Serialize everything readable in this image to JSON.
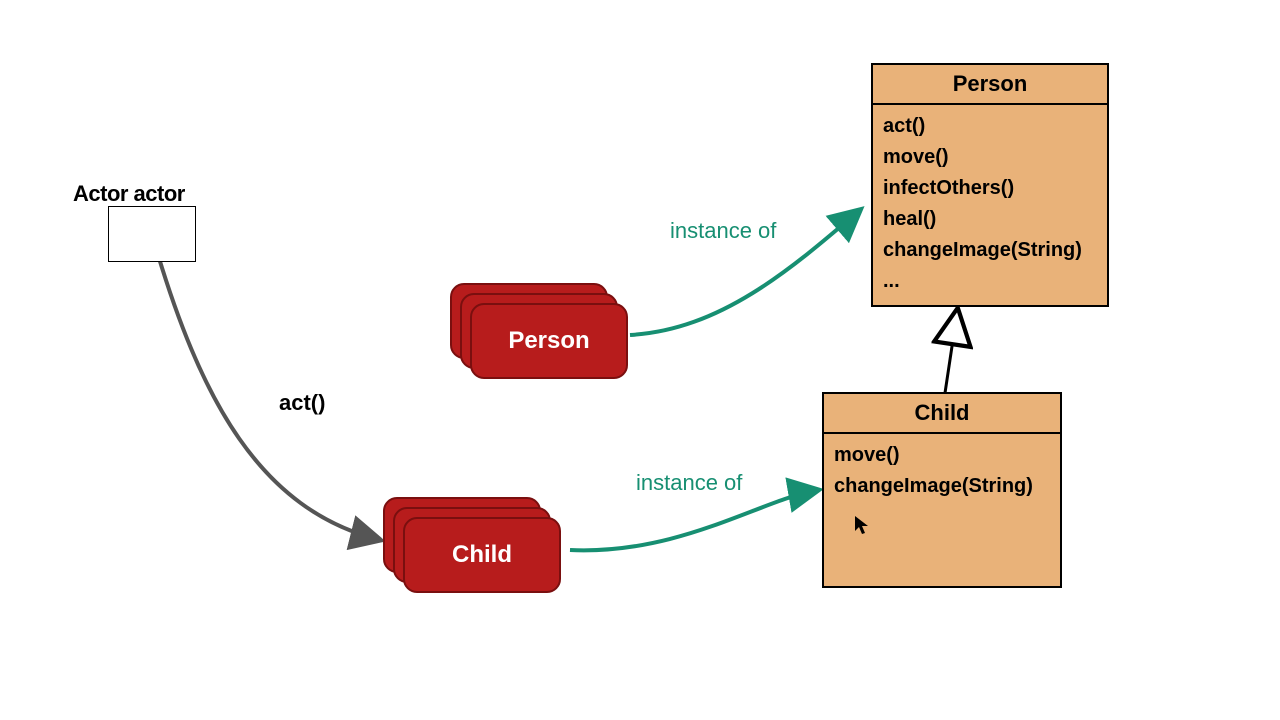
{
  "actor": {
    "type_label": "Actor actor"
  },
  "objects": {
    "person_card_label": "Person",
    "child_card_label": "Child"
  },
  "edges": {
    "act_label": "act()",
    "instance_of_top": "instance of",
    "instance_of_bottom": "instance of"
  },
  "classes": {
    "person": {
      "name": "Person",
      "methods": [
        "act()",
        "move()",
        "infectOthers()",
        "heal()",
        "changeImage(String)",
        "..."
      ]
    },
    "child": {
      "name": "Child",
      "methods": [
        "move()",
        "changeImage(String)"
      ]
    }
  },
  "colors": {
    "card_bg": "#B71C1C",
    "uml_bg": "#E9B279",
    "teal": "#178F72",
    "grey_arrow": "#555555"
  }
}
